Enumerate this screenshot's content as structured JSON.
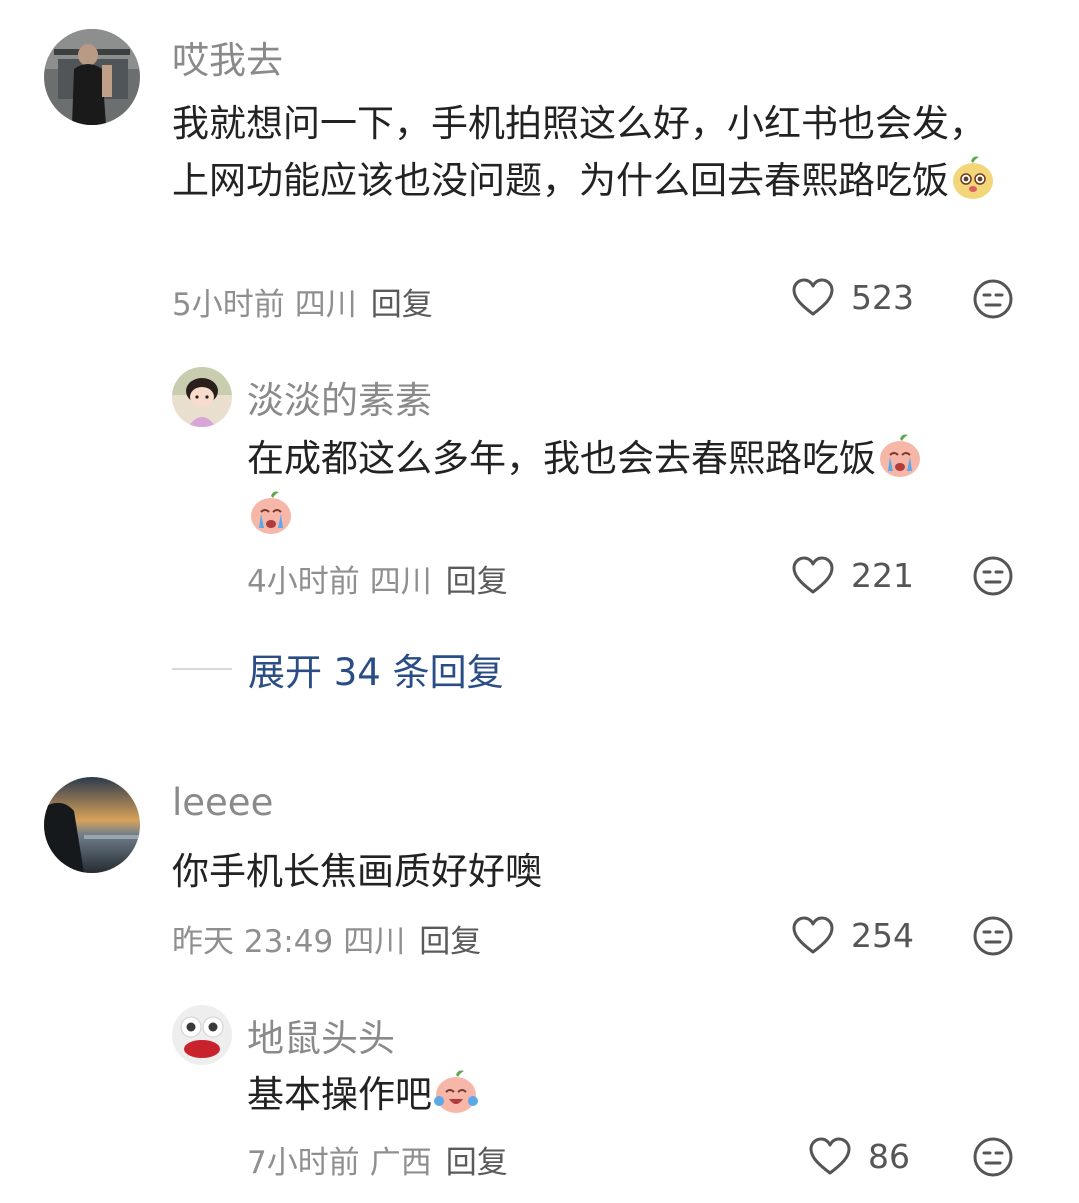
{
  "comments": [
    {
      "username": "哎我去",
      "text": "我就想问一下，手机拍照这么好，小红书也会发，上网功能应该也没问题，为什么回去春熙路吃饭",
      "time": "5小时前",
      "location": "四川",
      "reply_label": "回复",
      "likes": "523",
      "emoji": "puppy-emoji"
    },
    {
      "username": "淡淡的素素",
      "text": "在成都这么多年，我也会去春熙路吃饭",
      "time": "4小时前",
      "location": "四川",
      "reply_label": "回复",
      "likes": "221",
      "emoji": "crying-emoji"
    },
    {
      "username": "leeee",
      "text": "你手机长焦画质好好噢",
      "time": "昨天 23:49",
      "location": "四川",
      "reply_label": "回复",
      "likes": "254"
    },
    {
      "username": "地鼠头头",
      "text": "基本操作吧",
      "time": "7小时前",
      "location": "广西",
      "reply_label": "回复",
      "likes": "86",
      "emoji": "laugh-cry-emoji"
    }
  ],
  "expand_replies": "展开 34 条回复",
  "colors": {
    "username": "#8a8a8a",
    "meta": "#8f8f8f",
    "link": "#2a4d86",
    "text": "#222222"
  }
}
